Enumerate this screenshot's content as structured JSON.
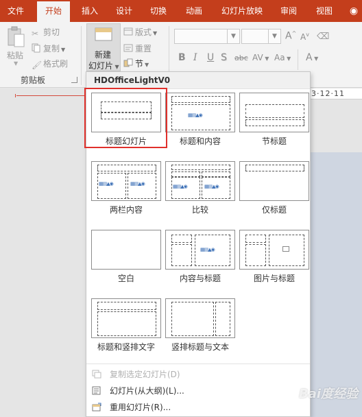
{
  "tabs": [
    "文件",
    "开始",
    "插入",
    "设计",
    "切换",
    "动画",
    "幻灯片放映",
    "审阅",
    "视图"
  ],
  "active_tab": "开始",
  "clipboard": {
    "paste_label": "粘贴",
    "cut_label": "剪切",
    "copy_label": "复制",
    "format_painter_label": "格式刷",
    "group_label": "剪贴板"
  },
  "slides_group": {
    "new_slide_line1": "新建",
    "new_slide_line2": "幻灯片",
    "layout_label": "版式",
    "reset_label": "重置",
    "section_label": "节"
  },
  "font_group": {
    "bold": "B",
    "italic": "I",
    "underline": "U",
    "shadow": "S",
    "strikethrough": "abc",
    "spacing": "AV",
    "change_case": "Aa",
    "grow": "A",
    "shrink": "A",
    "font_color": "A"
  },
  "ruler_text": "3·12·11",
  "dropdown": {
    "theme_name": "HDOfficeLightV0",
    "layouts": [
      "标题幻灯片",
      "标题和内容",
      "节标题",
      "两栏内容",
      "比较",
      "仅标题",
      "空白",
      "内容与标题",
      "图片与标题",
      "标题和竖排文字",
      "竖排标题与文本"
    ],
    "selected_layout": "标题幻灯片",
    "menu_items": [
      {
        "label": "复制选定幻灯片(D)",
        "disabled": true
      },
      {
        "label": "幻灯片(从大纲)(L)...",
        "disabled": false
      },
      {
        "label": "重用幻灯片(R)...",
        "disabled": false
      }
    ]
  },
  "watermark": "Bai度经验",
  "colors": {
    "ribbon_red": "#c43e1c",
    "highlight_red": "#e0302b"
  }
}
